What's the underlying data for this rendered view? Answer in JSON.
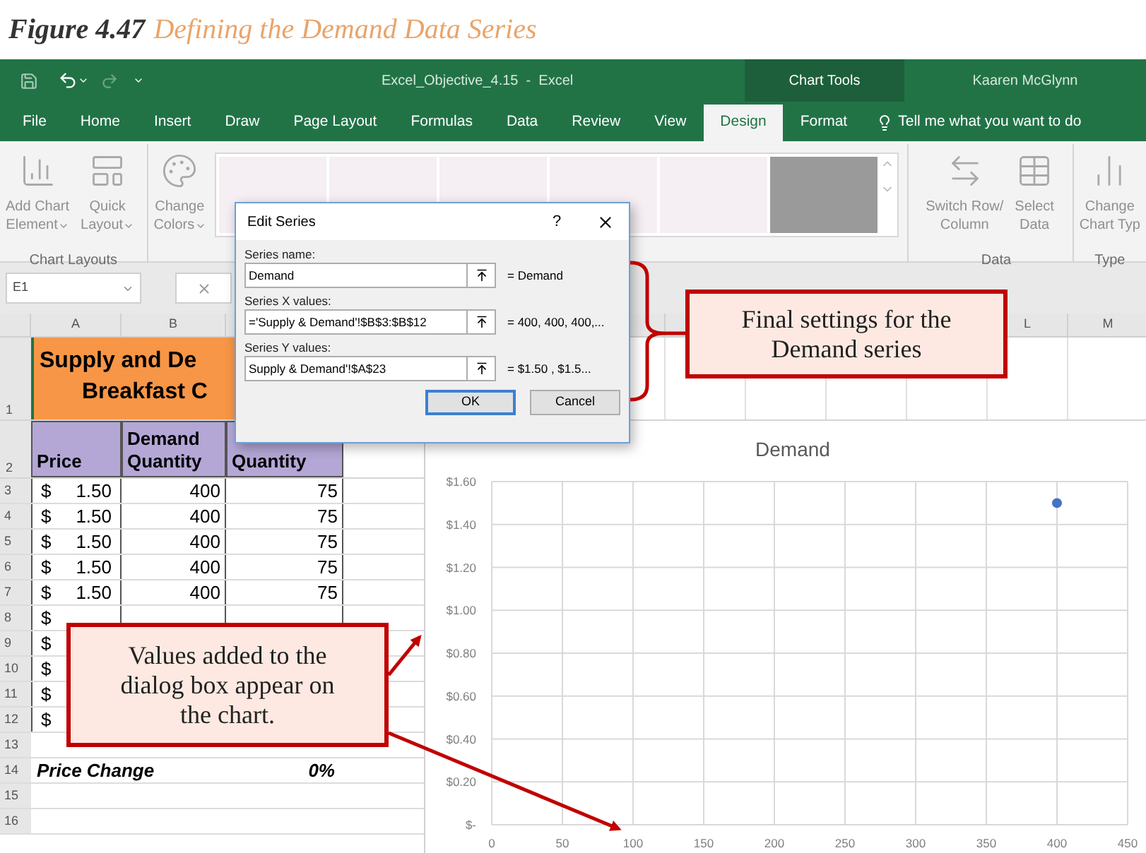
{
  "caption": {
    "label": "Figure 4.47",
    "title": "Defining the Demand Data Series"
  },
  "title_bar": {
    "document": "Excel_Objective_4.15  -  Excel",
    "context": "Chart Tools",
    "user": "Kaaren McGlynn"
  },
  "tabs": [
    {
      "label": "File",
      "selected": false
    },
    {
      "label": "Home",
      "selected": false
    },
    {
      "label": "Insert",
      "selected": false
    },
    {
      "label": "Draw",
      "selected": false
    },
    {
      "label": "Page Layout",
      "selected": false
    },
    {
      "label": "Formulas",
      "selected": false
    },
    {
      "label": "Data",
      "selected": false
    },
    {
      "label": "Review",
      "selected": false
    },
    {
      "label": "View",
      "selected": false
    },
    {
      "label": "Design",
      "selected": true
    },
    {
      "label": "Format",
      "selected": false
    }
  ],
  "tell_me": "Tell me what you want to do",
  "ribbon": {
    "groups": [
      {
        "label": "Chart Layouts",
        "buttons": [
          {
            "kind": "add_element",
            "lines": [
              "Add Chart",
              "Element"
            ],
            "dropdown": true
          },
          {
            "kind": "quick_layout",
            "lines": [
              "Quick",
              "Layout"
            ],
            "dropdown": true
          }
        ]
      },
      {
        "buttons": [
          {
            "kind": "change_colors",
            "lines": [
              "Change",
              "Colors"
            ],
            "dropdown": true
          }
        ],
        "styles": [
          {
            "kind": "light"
          },
          {
            "kind": "light"
          },
          {
            "kind": "light"
          },
          {
            "kind": "light"
          },
          {
            "kind": "light"
          },
          {
            "kind": "dark"
          }
        ]
      },
      {
        "label": "Data",
        "buttons": [
          {
            "kind": "switch",
            "lines": [
              "Switch Row/",
              "Column"
            ],
            "dropdown": false
          },
          {
            "kind": "select_data",
            "lines": [
              "Select",
              "Data"
            ],
            "dropdown": false
          }
        ]
      },
      {
        "label": "Type",
        "buttons": [
          {
            "kind": "change_type",
            "lines": [
              "Change",
              "Chart Typ"
            ],
            "dropdown": false
          }
        ]
      }
    ]
  },
  "formula_bar": {
    "name_box": "E1"
  },
  "columns": [
    "A",
    "B",
    "L",
    "M"
  ],
  "sheet": {
    "title": [
      "Supply and De",
      "Breakfast C"
    ],
    "headers": [
      "Price",
      "Demand Quantity",
      "Quantity"
    ],
    "rows": [
      {
        "number": "3",
        "symbol": "$",
        "price": "1.50",
        "demand": "400",
        "supply": "75"
      },
      {
        "number": "4",
        "symbol": "$",
        "price": "1.50",
        "demand": "400",
        "supply": "75"
      },
      {
        "number": "5",
        "symbol": "$",
        "price": "1.50",
        "demand": "400",
        "supply": "75"
      },
      {
        "number": "6",
        "symbol": "$",
        "price": "1.50",
        "demand": "400",
        "supply": "75"
      },
      {
        "number": "7",
        "symbol": "$",
        "price": "1.50",
        "demand": "400",
        "supply": "75"
      },
      {
        "number": "8",
        "symbol": "$"
      },
      {
        "number": "9",
        "symbol": "$"
      },
      {
        "number": "10",
        "symbol": "$"
      },
      {
        "number": "11",
        "symbol": "$"
      },
      {
        "number": "12",
        "symbol": "$"
      },
      {
        "number": "13"
      },
      {
        "number": "14",
        "label": "Price Change",
        "value": "0%"
      },
      {
        "number": "15"
      },
      {
        "number": "16"
      }
    ],
    "row_1": "1",
    "row_2": "2"
  },
  "chart": {
    "chart_data": {
      "type": "scatter",
      "title": "Demand",
      "x": [
        400
      ],
      "series": [
        {
          "color": "#4472c4",
          "values": [
            1.5
          ]
        }
      ],
      "grid": true,
      "xlim": [
        0,
        450
      ],
      "ylim": [
        0,
        1.6
      ],
      "xticks": [
        0,
        50,
        100,
        150,
        200,
        250,
        300,
        350,
        400,
        450
      ],
      "yticks": [
        {
          "value": 0,
          "label": "$-"
        },
        {
          "value": 0.2,
          "label": "$0.20"
        },
        {
          "value": 0.4,
          "label": "$0.40"
        },
        {
          "value": 0.6,
          "label": "$0.60"
        },
        {
          "value": 0.8,
          "label": "$0.80"
        },
        {
          "value": 1.0,
          "label": "$1.00"
        },
        {
          "value": 1.2,
          "label": "$1.20"
        },
        {
          "value": 1.4,
          "label": "$1.40"
        },
        {
          "value": 1.6,
          "label": "$1.60"
        }
      ]
    }
  },
  "dialog": {
    "title": "Edit Series",
    "help": "?",
    "fields": [
      {
        "label": "Series name:",
        "value": "Demand",
        "result": "= Demand"
      },
      {
        "label": "Series X values:",
        "value": "='Supply & Demand'!$B$3:$B$12",
        "result": "= 400, 400, 400,..."
      },
      {
        "label": "Series Y values:",
        "value": "Supply & Demand'!$A$23",
        "result": "= $1.50 , $1.5..."
      }
    ],
    "buttons": [
      {
        "label": "OK",
        "default": true
      },
      {
        "label": "Cancel",
        "default": false
      }
    ]
  },
  "callouts": [
    {
      "text": "Final settings for the Demand series"
    },
    {
      "text": "Values added to the dialog box appear on the chart."
    }
  ]
}
